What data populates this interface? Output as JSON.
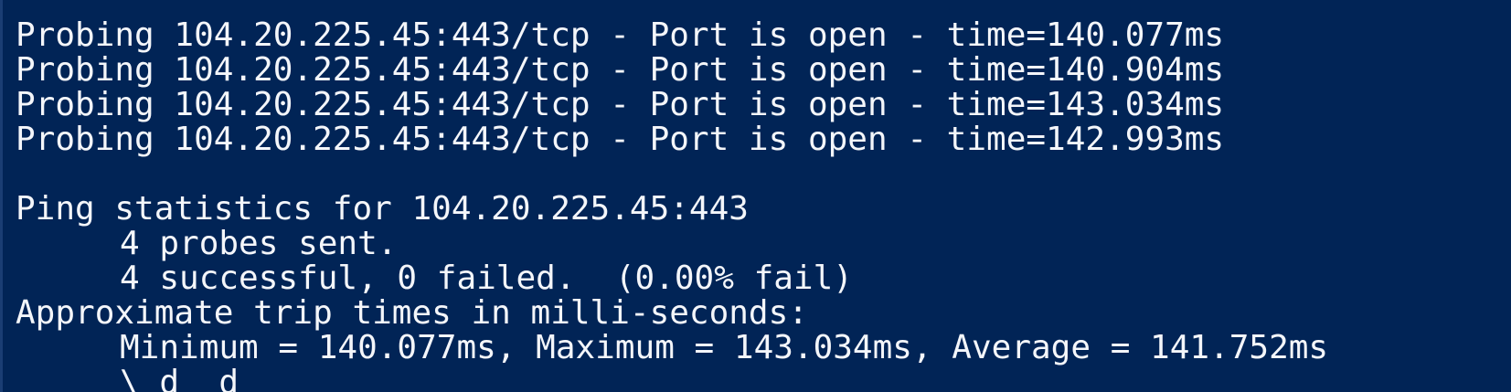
{
  "console": {
    "probes": [
      "Probing 104.20.225.45:443/tcp - Port is open - time=140.077ms",
      "Probing 104.20.225.45:443/tcp - Port is open - time=140.904ms",
      "Probing 104.20.225.45:443/tcp - Port is open - time=143.034ms",
      "Probing 104.20.225.45:443/tcp - Port is open - time=142.993ms"
    ],
    "stats_header": "Ping statistics for 104.20.225.45:443",
    "probes_sent": "4 probes sent.",
    "success_summary": "4 successful, 0 failed.  (0.00% fail)",
    "trip_header": "Approximate trip times in milli-seconds:",
    "trip_summary": "Minimum = 140.077ms, Maximum = 143.034ms, Average = 141.752ms",
    "partial_line": "\\ d  d"
  },
  "colors": {
    "background": "#012456",
    "text": "#f4f6fa"
  }
}
